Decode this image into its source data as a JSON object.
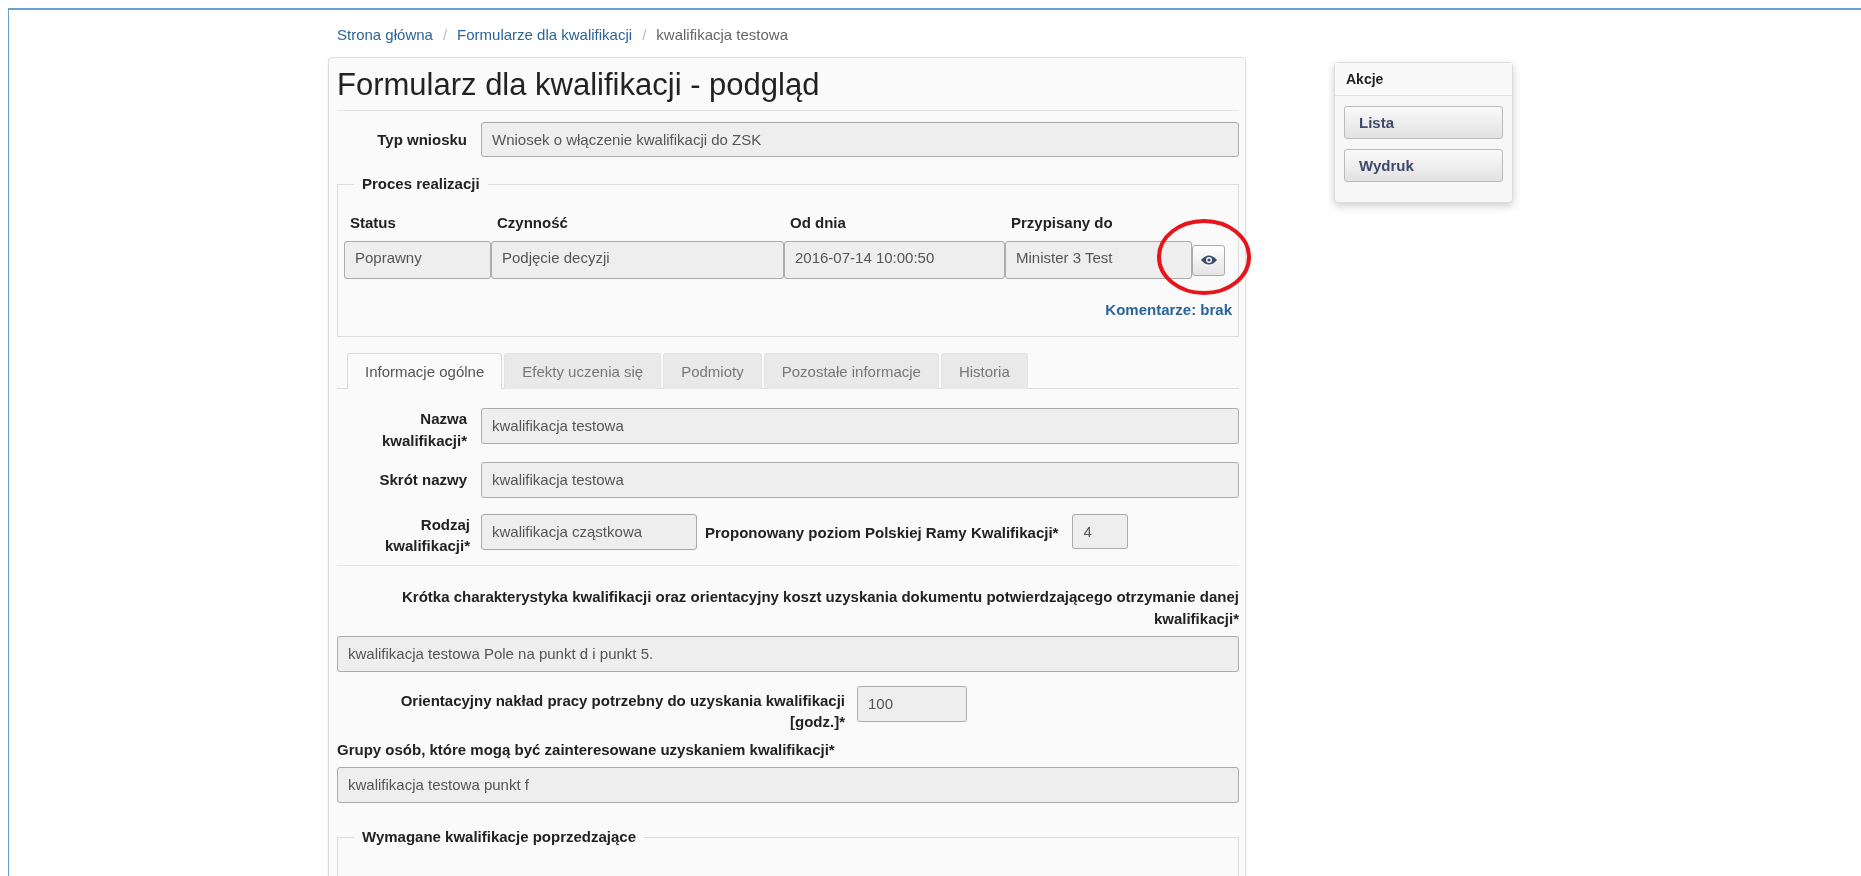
{
  "breadcrumb": [
    {
      "label": "Strona główna",
      "kind": "link"
    },
    {
      "separator": "/",
      "label": "Formularze dla kwalifikacji",
      "kind": "link"
    },
    {
      "separator": "/",
      "label": "kwalifikacja testowa",
      "kind": "current"
    }
  ],
  "title": "Formularz dla kwalifikacji - podgląd",
  "request_type": {
    "label": "Typ wniosku",
    "value": "Wniosek o włączenie kwalifikacji do ZSK"
  },
  "process": {
    "legend": "Proces realizacji",
    "columns": [
      "Status",
      "Czynność",
      "Od dnia",
      "Przypisany do"
    ],
    "values": [
      "Poprawny",
      "Podjęcie decyzji",
      "2016-07-14 10:00:50",
      "Minister 3 Test"
    ],
    "comments_link": "Komentarze: brak"
  },
  "annotations": [
    {
      "kind": "ellipse"
    }
  ],
  "tabs": [
    {
      "label": "Informacje ogólne",
      "selected": true
    },
    {
      "label": "Efekty uczenia się",
      "selected": false
    },
    {
      "label": "Podmioty",
      "selected": false
    },
    {
      "label": "Pozostałe informacje",
      "selected": false
    },
    {
      "label": "Historia",
      "selected": false
    }
  ],
  "fields": {
    "name": {
      "label": "Nazwa kwalifikacji*",
      "value": "kwalifikacja testowa"
    },
    "short_name": {
      "label": "Skrót nazwy",
      "value": "kwalifikacja testowa"
    },
    "type": {
      "label": "Rodzaj kwalifikacji*",
      "value": "kwalifikacja cząstkowa"
    },
    "level": {
      "label": "Proponowany poziom Polskiej Ramy Kwalifikacji*",
      "value": "4"
    },
    "description": {
      "label": "Krótka charakterystyka kwalifikacji oraz orientacyjny koszt uzyskania dokumentu potwierdzającego otrzymanie danej kwalifikacji*",
      "value": "kwalifikacja testowa Pole na punkt d i punkt 5."
    },
    "workload": {
      "label": "Orientacyjny nakład pracy potrzebny do uzyskania kwalifikacji [godz.]*",
      "value": "100"
    },
    "groups": {
      "label": "Grupy osób, które mogą być zainteresowane uzyskaniem kwalifikacji*",
      "value": "kwalifikacja testowa punkt f"
    }
  },
  "required_legend": "Wymagane kwalifikacje poprzedzające",
  "actions": {
    "title": "Akcje",
    "buttons": [
      "Lista",
      "Wydruk"
    ]
  }
}
